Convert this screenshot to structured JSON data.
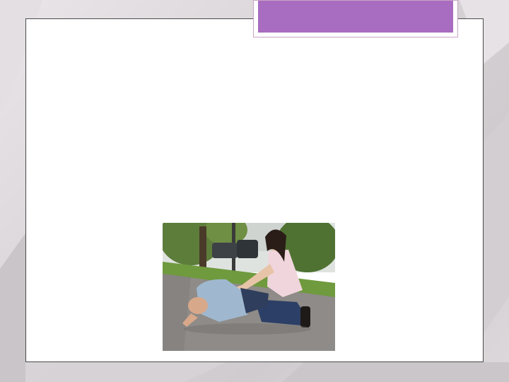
{
  "slide": {
    "title": "",
    "accent_color": "#a86cc0",
    "frame_border_color": "#4a4a4a"
  },
  "photo": {
    "subject": "first-aid-recovery-position-photo"
  }
}
